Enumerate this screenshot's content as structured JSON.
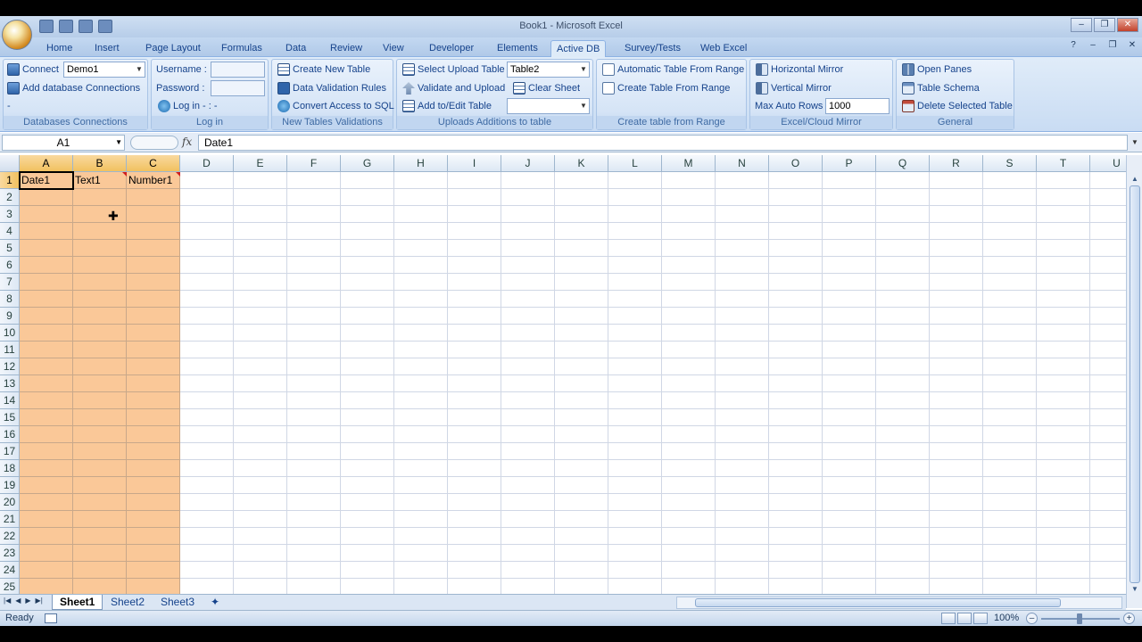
{
  "window": {
    "title": "Book1 - Microsoft Excel",
    "minimize": "–",
    "restore": "❐",
    "close": "✕"
  },
  "ribbon_tabs": [
    "Home",
    "Insert",
    "Page Layout",
    "Formulas",
    "Data",
    "Review",
    "View",
    "Developer",
    "Elements",
    "Active DB",
    "Survey/Tests",
    "Web Excel"
  ],
  "active_tab": "Active DB",
  "help": {
    "help": "?",
    "min": "–",
    "restore": "❐",
    "close": "✕"
  },
  "groups": {
    "db_connections": {
      "label": "Databases Connections",
      "connect": "Connect",
      "connect_value": "Demo1",
      "add": "Add database Connections",
      "dash": "-"
    },
    "login": {
      "label": "Log in",
      "username": "Username  :",
      "password": "Password  :",
      "login_btn": "Log in - : -"
    },
    "new_tables": {
      "label": "New Tables  Validations",
      "create": "Create New Table",
      "validation": "Data Validation Rules",
      "convert": "Convert Access to SQL"
    },
    "uploads": {
      "label": "Uploads  Additions to table",
      "select": "Select Upload Table",
      "select_value": "Table2",
      "validate": "Validate and Upload",
      "clear": "Clear Sheet",
      "add_edit": "Add to/Edit Table",
      "add_edit_value": ""
    },
    "create_range": {
      "label": "Create table from Range",
      "auto": "Automatic Table From Range",
      "create": "Create Table From Range"
    },
    "mirror": {
      "label": "Excel/Cloud Mirror",
      "horizontal": "Horizontal Mirror",
      "vertical": "Vertical Mirror",
      "max_rows": "Max Auto Rows",
      "max_rows_value": "1000"
    },
    "general": {
      "label": "General",
      "open_panes": "Open Panes",
      "schema": "Table Schema",
      "delete": "Delete Selected Table"
    }
  },
  "formula_bar": {
    "name_box": "A1",
    "fx": "fx",
    "value": "Date1"
  },
  "columns": [
    "A",
    "B",
    "C",
    "D",
    "E",
    "F",
    "G",
    "H",
    "I",
    "J",
    "K",
    "L",
    "M",
    "N",
    "O",
    "P",
    "Q",
    "R",
    "S",
    "T",
    "U"
  ],
  "rows": [
    "1",
    "2",
    "3",
    "4",
    "5",
    "6",
    "7",
    "8",
    "9",
    "10",
    "11",
    "12",
    "13",
    "14",
    "15",
    "16",
    "17",
    "18",
    "19",
    "20",
    "21",
    "22",
    "23",
    "24",
    "25"
  ],
  "cells": {
    "A1": "Date1",
    "B1": "Text1",
    "C1": "Number1"
  },
  "sheets": [
    "Sheet1",
    "Sheet2",
    "Sheet3"
  ],
  "active_sheet": "Sheet1",
  "status": {
    "ready": "Ready",
    "zoom": "100%",
    "zoom_out": "–",
    "zoom_in": "+"
  },
  "colors": {
    "highlight": "#fac898",
    "selected_header": "#f1c15f",
    "ribbon": "#d5e4f6"
  }
}
